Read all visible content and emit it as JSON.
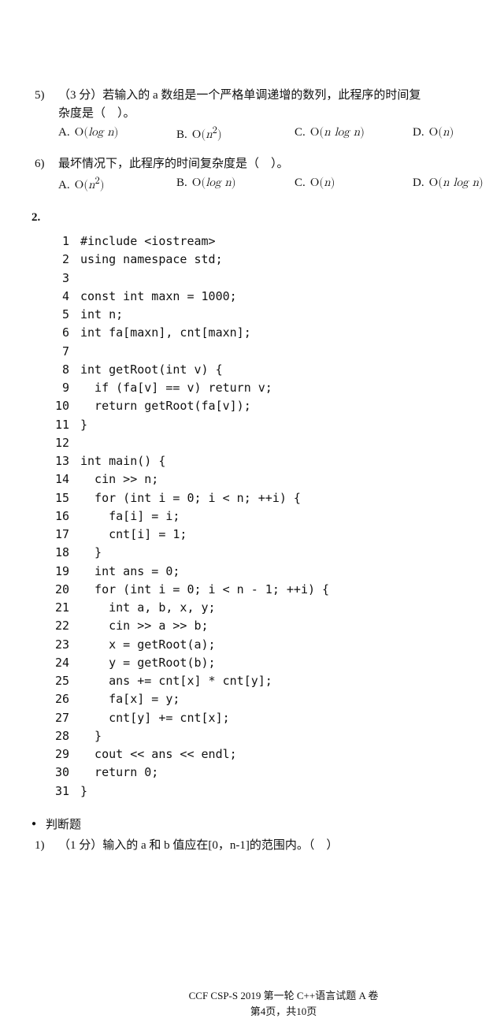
{
  "q5": {
    "num": "5)",
    "text_l1": "（3 分）若输入的 a 数组是一个严格单调递增的数列，此程序的时间复",
    "text_l2": "杂度是（　）。",
    "opts": {
      "A": {
        "lab": "A.",
        "math": "O(log n)"
      },
      "B": {
        "lab": "B.",
        "math": "O(n²)"
      },
      "C": {
        "lab": "C.",
        "math": "O(n log n)"
      },
      "D": {
        "lab": "D.",
        "math": "O(n)"
      }
    }
  },
  "q6": {
    "num": "6)",
    "text": "最坏情况下，此程序的时间复杂度是（　）。",
    "opts": {
      "A": {
        "lab": "A.",
        "math": "O(n²)"
      },
      "B": {
        "lab": "B.",
        "math": "O(log n)"
      },
      "C": {
        "lab": "C.",
        "math": "O(n)"
      },
      "D": {
        "lab": "D.",
        "math": "O(n log n)"
      }
    }
  },
  "sec2": "2.",
  "code": [
    "#include <iostream>",
    "using namespace std;",
    "",
    "const int maxn = 1000;",
    "int n;",
    "int fa[maxn], cnt[maxn];",
    "",
    "int getRoot(int v) {",
    "  if (fa[v] == v) return v;",
    "  return getRoot(fa[v]);",
    "}",
    "",
    "int main() {",
    "  cin >> n;",
    "  for (int i = 0; i < n; ++i) {",
    "    fa[i] = i;",
    "    cnt[i] = 1;",
    "  }",
    "  int ans = 0;",
    "  for (int i = 0; i < n - 1; ++i) {",
    "    int a, b, x, y;",
    "    cin >> a >> b;",
    "    x = getRoot(a);",
    "    y = getRoot(b);",
    "    ans += cnt[x] * cnt[y];",
    "    fa[x] = y;",
    "    cnt[y] += cnt[x];",
    "  }",
    "  cout << ans << endl;",
    "  return 0;",
    "}"
  ],
  "judge_head": "判断题",
  "judge1": {
    "num": "1)",
    "text": "（1 分）输入的 a 和 b 值应在[0，n-1]的范围内。（　）"
  },
  "footer": {
    "l1": "CCF CSP-S 2019 第一轮 C++语言试题 A 卷",
    "l2": "第4页，共10页"
  }
}
